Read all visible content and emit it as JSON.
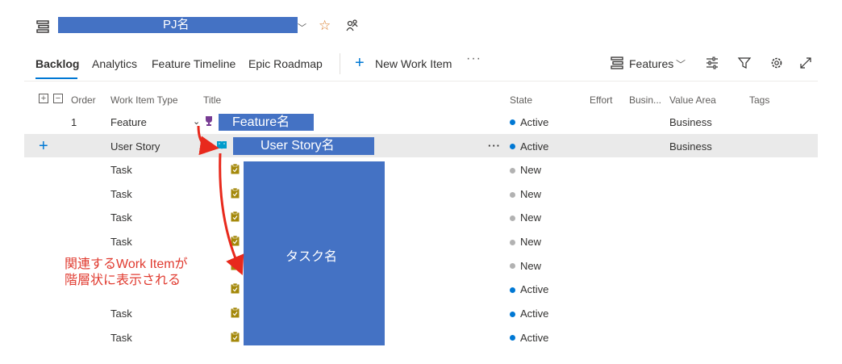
{
  "project": {
    "name": "PJ名"
  },
  "tabs": [
    {
      "label": "Backlog"
    },
    {
      "label": "Analytics"
    },
    {
      "label": "Feature Timeline"
    },
    {
      "label": "Epic Roadmap"
    }
  ],
  "toolbar": {
    "new_work_item": "New Work Item",
    "more": "···",
    "level_selector": "Features"
  },
  "icons": {
    "backlog": "backlog-icon",
    "favorite": "star-icon",
    "team": "team-icon",
    "add": "plus-icon",
    "filter": "funnel-icon",
    "settings": "gear-icon",
    "fullscreen": "expand-icon",
    "view_options": "sliders-icon",
    "feature": "trophy-icon",
    "user_story": "book-icon",
    "task": "clipboard-icon"
  },
  "colors": {
    "accent": "#0078d4",
    "redaction": "#4472C4",
    "feature": "#773b93",
    "story": "#009ccc",
    "task": "#a4880a",
    "annotation": "#e03a2f",
    "state_new": "#b2b2b2"
  },
  "columns": {
    "order": "Order",
    "work_item_type": "Work Item Type",
    "title": "Title",
    "state": "State",
    "effort": "Effort",
    "business_value": "Busin...",
    "value_area": "Value Area",
    "tags": "Tags"
  },
  "expand_controls": {
    "expand_all": "+",
    "collapse_all": "−"
  },
  "rows": [
    {
      "order": "1",
      "type": "Feature",
      "title": "Feature名",
      "state": "Active",
      "value_area": "Business"
    },
    {
      "order": "",
      "type": "User Story",
      "title": "User Story名",
      "state": "Active",
      "value_area": "Business"
    },
    {
      "type": "Task",
      "state": "New"
    },
    {
      "type": "Task",
      "state": "New"
    },
    {
      "type": "Task",
      "state": "New"
    },
    {
      "type": "Task",
      "state": "New"
    },
    {
      "type": "",
      "state": "New"
    },
    {
      "type": "",
      "state": "Active"
    },
    {
      "type": "Task",
      "state": "Active"
    },
    {
      "type": "Task",
      "state": "Active"
    }
  ],
  "task_title": "タスク名",
  "annotation": {
    "line1": "関連するWork Itemが",
    "line2": "階層状に表示される"
  }
}
